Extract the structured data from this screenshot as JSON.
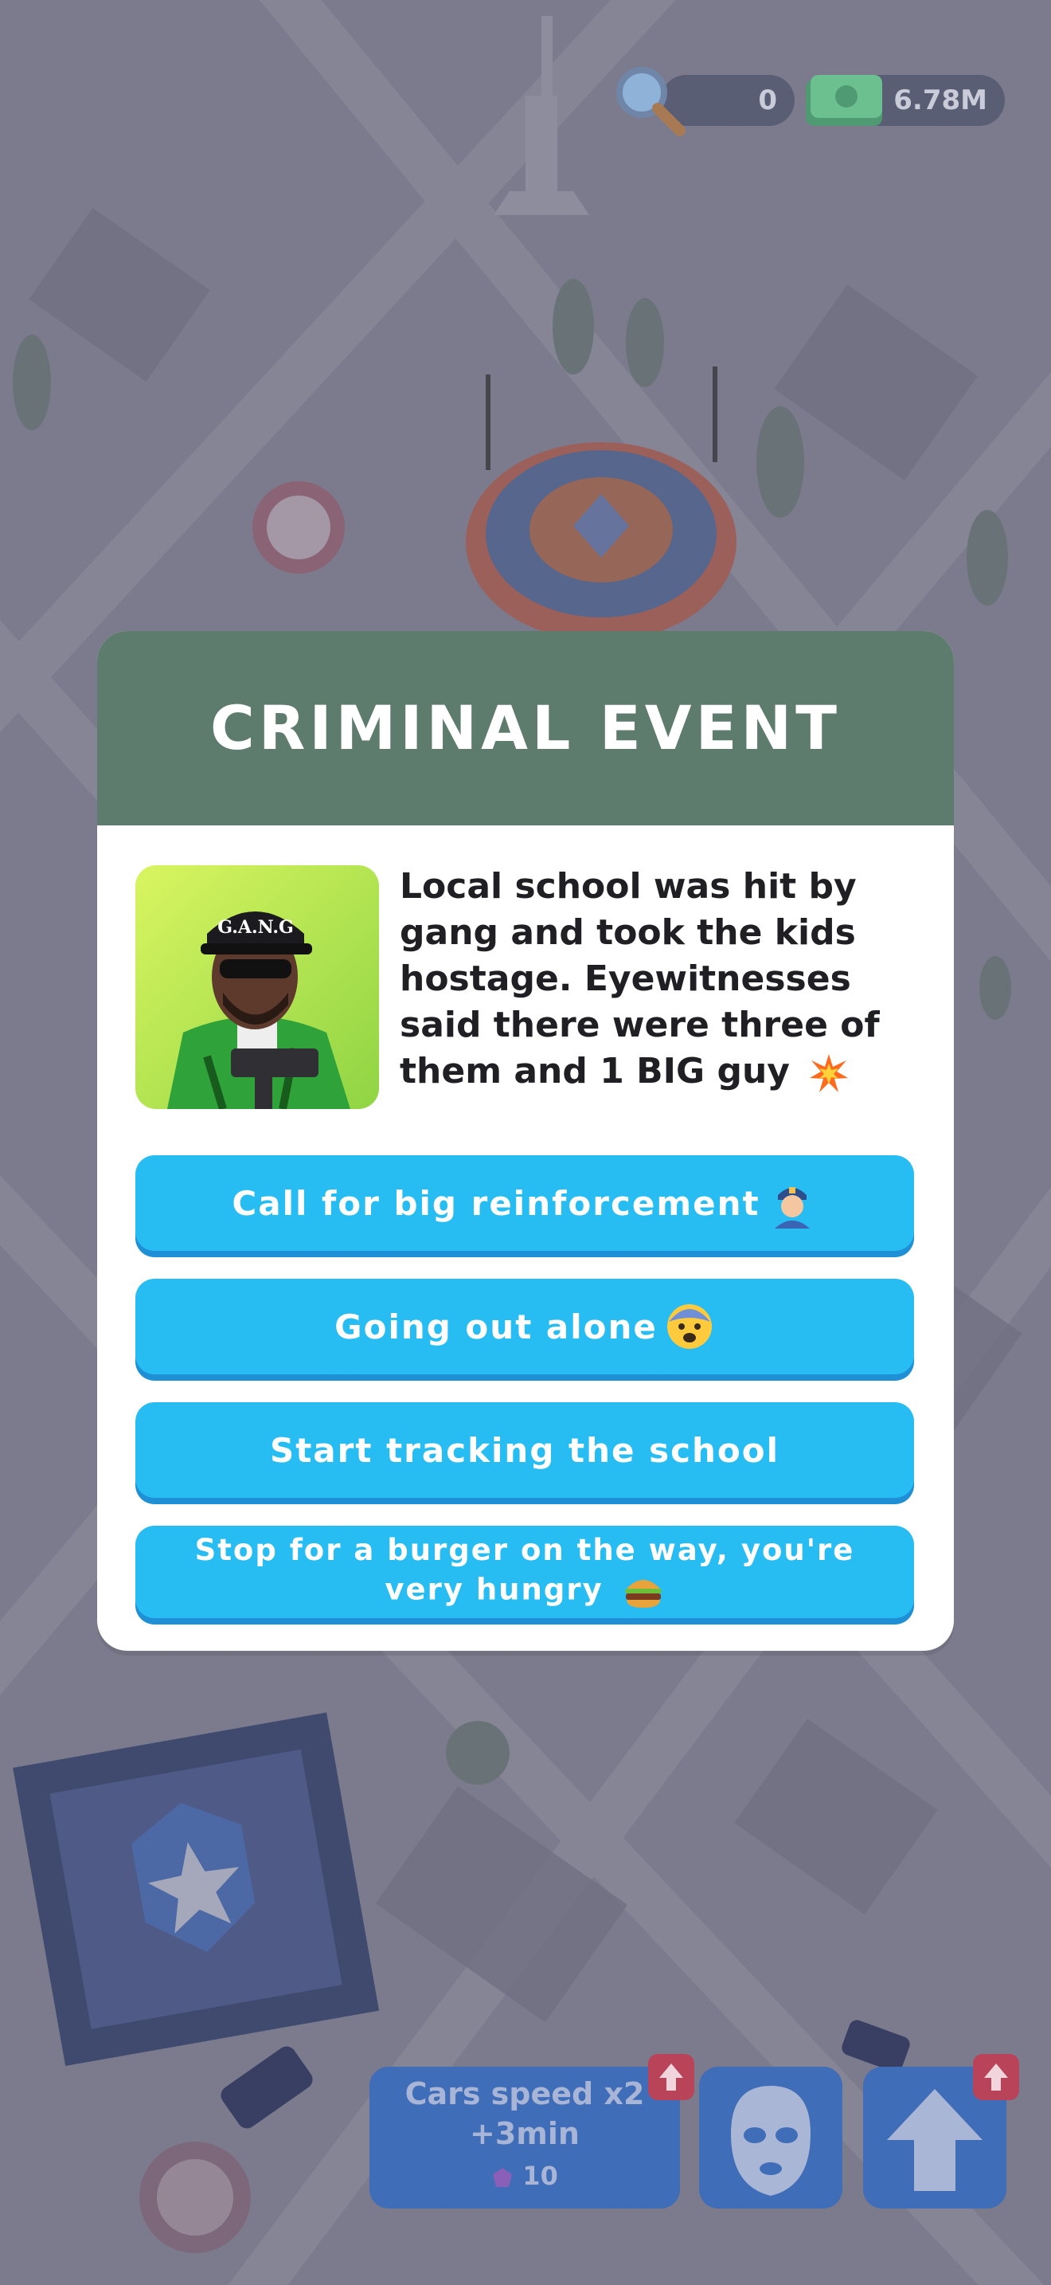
{
  "hud": {
    "search_count": "0",
    "money": "6.78M"
  },
  "dialog": {
    "title": "CRIMINAL EVENT",
    "description": "Local school was hit by gang and took the kids hostage. Eyewitnesses said there were three of them and 1 BIG guy",
    "description_emoji": "collision-emoji",
    "portrait_cap_text": "G.A.N.G",
    "options": [
      {
        "label": "Call for big reinforcement",
        "emoji": "police-officer-emoji"
      },
      {
        "label": "Going out alone",
        "emoji": "fearful-face-emoji"
      },
      {
        "label": "Start tracking the school",
        "emoji": ""
      },
      {
        "label": "Stop for a burger on the way, you're very hungry",
        "emoji": "burger-emoji"
      }
    ]
  },
  "bottom_hud": {
    "boost_line1": "Cars speed x2",
    "boost_line2": "+3min",
    "boost_cost": "10"
  },
  "colors": {
    "header": "#5e7c6d",
    "option_button": "#28bdf2",
    "option_shadow": "#1f8fd6",
    "hud_button": "#3f6db7"
  }
}
